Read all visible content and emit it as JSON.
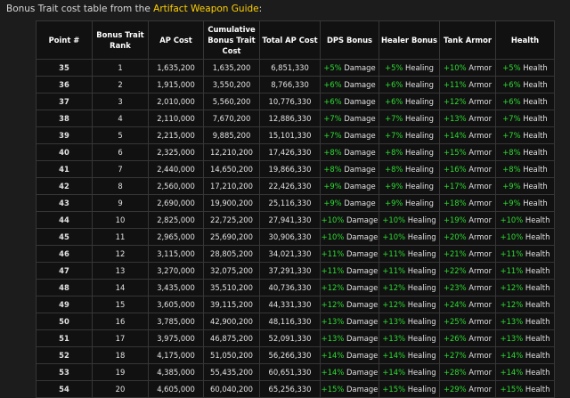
{
  "intro": {
    "prefix": "Bonus Trait cost table from the ",
    "link": "Artifact Weapon Guide",
    "suffix": ":"
  },
  "columns": [
    "Point #",
    "Bonus Trait Rank",
    "AP Cost",
    "Cumulative Bonus Trait Cost",
    "Total AP Cost",
    "DPS Bonus",
    "Healer Bonus",
    "Tank Armor",
    "Health"
  ],
  "rows": [
    {
      "point": "35",
      "rank": "1",
      "ap_cost": "1,635,200",
      "cumulative": "1,635,200",
      "total": "6,851,330",
      "dps_pct": "+5%",
      "dps_label": "Damage",
      "healer_pct": "+5%",
      "healer_label": "Healing",
      "armor_pct": "+10%",
      "armor_label": "Armor",
      "health_pct": "+5%",
      "health_label": "Health"
    },
    {
      "point": "36",
      "rank": "2",
      "ap_cost": "1,915,000",
      "cumulative": "3,550,200",
      "total": "8,766,330",
      "dps_pct": "+6%",
      "dps_label": "Damage",
      "healer_pct": "+6%",
      "healer_label": "Healing",
      "armor_pct": "+11%",
      "armor_label": "Armor",
      "health_pct": "+6%",
      "health_label": "Health"
    },
    {
      "point": "37",
      "rank": "3",
      "ap_cost": "2,010,000",
      "cumulative": "5,560,200",
      "total": "10,776,330",
      "dps_pct": "+6%",
      "dps_label": "Damage",
      "healer_pct": "+6%",
      "healer_label": "Healing",
      "armor_pct": "+12%",
      "armor_label": "Armor",
      "health_pct": "+6%",
      "health_label": "Health"
    },
    {
      "point": "38",
      "rank": "4",
      "ap_cost": "2,110,000",
      "cumulative": "7,670,200",
      "total": "12,886,330",
      "dps_pct": "+7%",
      "dps_label": "Damage",
      "healer_pct": "+7%",
      "healer_label": "Healing",
      "armor_pct": "+13%",
      "armor_label": "Armor",
      "health_pct": "+7%",
      "health_label": "Health"
    },
    {
      "point": "39",
      "rank": "5",
      "ap_cost": "2,215,000",
      "cumulative": "9,885,200",
      "total": "15,101,330",
      "dps_pct": "+7%",
      "dps_label": "Damage",
      "healer_pct": "+7%",
      "healer_label": "Healing",
      "armor_pct": "+14%",
      "armor_label": "Armor",
      "health_pct": "+7%",
      "health_label": "Health"
    },
    {
      "point": "40",
      "rank": "6",
      "ap_cost": "2,325,000",
      "cumulative": "12,210,200",
      "total": "17,426,330",
      "dps_pct": "+8%",
      "dps_label": "Damage",
      "healer_pct": "+8%",
      "healer_label": "Healing",
      "armor_pct": "+15%",
      "armor_label": "Armor",
      "health_pct": "+8%",
      "health_label": "Health"
    },
    {
      "point": "41",
      "rank": "7",
      "ap_cost": "2,440,000",
      "cumulative": "14,650,200",
      "total": "19,866,330",
      "dps_pct": "+8%",
      "dps_label": "Damage",
      "healer_pct": "+8%",
      "healer_label": "Healing",
      "armor_pct": "+16%",
      "armor_label": "Armor",
      "health_pct": "+8%",
      "health_label": "Health"
    },
    {
      "point": "42",
      "rank": "8",
      "ap_cost": "2,560,000",
      "cumulative": "17,210,200",
      "total": "22,426,330",
      "dps_pct": "+9%",
      "dps_label": "Damage",
      "healer_pct": "+9%",
      "healer_label": "Healing",
      "armor_pct": "+17%",
      "armor_label": "Armor",
      "health_pct": "+9%",
      "health_label": "Health"
    },
    {
      "point": "43",
      "rank": "9",
      "ap_cost": "2,690,000",
      "cumulative": "19,900,200",
      "total": "25,116,330",
      "dps_pct": "+9%",
      "dps_label": "Damage",
      "healer_pct": "+9%",
      "healer_label": "Healing",
      "armor_pct": "+18%",
      "armor_label": "Armor",
      "health_pct": "+9%",
      "health_label": "Health"
    },
    {
      "point": "44",
      "rank": "10",
      "ap_cost": "2,825,000",
      "cumulative": "22,725,200",
      "total": "27,941,330",
      "dps_pct": "+10%",
      "dps_label": "Damage",
      "healer_pct": "+10%",
      "healer_label": "Healing",
      "armor_pct": "+19%",
      "armor_label": "Armor",
      "health_pct": "+10%",
      "health_label": "Health"
    },
    {
      "point": "45",
      "rank": "11",
      "ap_cost": "2,965,000",
      "cumulative": "25,690,200",
      "total": "30,906,330",
      "dps_pct": "+10%",
      "dps_label": "Damage",
      "healer_pct": "+10%",
      "healer_label": "Healing",
      "armor_pct": "+20%",
      "armor_label": "Armor",
      "health_pct": "+10%",
      "health_label": "Health"
    },
    {
      "point": "46",
      "rank": "12",
      "ap_cost": "3,115,000",
      "cumulative": "28,805,200",
      "total": "34,021,330",
      "dps_pct": "+11%",
      "dps_label": "Damage",
      "healer_pct": "+11%",
      "healer_label": "Healing",
      "armor_pct": "+21%",
      "armor_label": "Armor",
      "health_pct": "+11%",
      "health_label": "Health"
    },
    {
      "point": "47",
      "rank": "13",
      "ap_cost": "3,270,000",
      "cumulative": "32,075,200",
      "total": "37,291,330",
      "dps_pct": "+11%",
      "dps_label": "Damage",
      "healer_pct": "+11%",
      "healer_label": "Healing",
      "armor_pct": "+22%",
      "armor_label": "Armor",
      "health_pct": "+11%",
      "health_label": "Health"
    },
    {
      "point": "48",
      "rank": "14",
      "ap_cost": "3,435,000",
      "cumulative": "35,510,200",
      "total": "40,736,330",
      "dps_pct": "+12%",
      "dps_label": "Damage",
      "healer_pct": "+12%",
      "healer_label": "Healing",
      "armor_pct": "+23%",
      "armor_label": "Armor",
      "health_pct": "+12%",
      "health_label": "Health"
    },
    {
      "point": "49",
      "rank": "15",
      "ap_cost": "3,605,000",
      "cumulative": "39,115,200",
      "total": "44,331,330",
      "dps_pct": "+12%",
      "dps_label": "Damage",
      "healer_pct": "+12%",
      "healer_label": "Healing",
      "armor_pct": "+24%",
      "armor_label": "Armor",
      "health_pct": "+12%",
      "health_label": "Health"
    },
    {
      "point": "50",
      "rank": "16",
      "ap_cost": "3,785,000",
      "cumulative": "42,900,200",
      "total": "48,116,330",
      "dps_pct": "+13%",
      "dps_label": "Damage",
      "healer_pct": "+13%",
      "healer_label": "Healing",
      "armor_pct": "+25%",
      "armor_label": "Armor",
      "health_pct": "+13%",
      "health_label": "Health"
    },
    {
      "point": "51",
      "rank": "17",
      "ap_cost": "3,975,000",
      "cumulative": "46,875,200",
      "total": "52,091,330",
      "dps_pct": "+13%",
      "dps_label": "Damage",
      "healer_pct": "+13%",
      "healer_label": "Healing",
      "armor_pct": "+26%",
      "armor_label": "Armor",
      "health_pct": "+13%",
      "health_label": "Health"
    },
    {
      "point": "52",
      "rank": "18",
      "ap_cost": "4,175,000",
      "cumulative": "51,050,200",
      "total": "56,266,330",
      "dps_pct": "+14%",
      "dps_label": "Damage",
      "healer_pct": "+14%",
      "healer_label": "Healing",
      "armor_pct": "+27%",
      "armor_label": "Armor",
      "health_pct": "+14%",
      "health_label": "Health"
    },
    {
      "point": "53",
      "rank": "19",
      "ap_cost": "4,385,000",
      "cumulative": "55,435,200",
      "total": "60,651,330",
      "dps_pct": "+14%",
      "dps_label": "Damage",
      "healer_pct": "+14%",
      "healer_label": "Healing",
      "armor_pct": "+28%",
      "armor_label": "Armor",
      "health_pct": "+14%",
      "health_label": "Health"
    },
    {
      "point": "54",
      "rank": "20",
      "ap_cost": "4,605,000",
      "cumulative": "60,040,200",
      "total": "65,256,330",
      "dps_pct": "+15%",
      "dps_label": "Damage",
      "healer_pct": "+15%",
      "healer_label": "Healing",
      "armor_pct": "+29%",
      "armor_label": "Armor",
      "health_pct": "+15%",
      "health_label": "Health"
    }
  ],
  "colors": {
    "background": "#1c1c1c",
    "table_background": "#111111",
    "link": "#ffd100",
    "point": "#ffd100",
    "rank": "#ff4a3d",
    "bonus": "#2ddb32"
  }
}
